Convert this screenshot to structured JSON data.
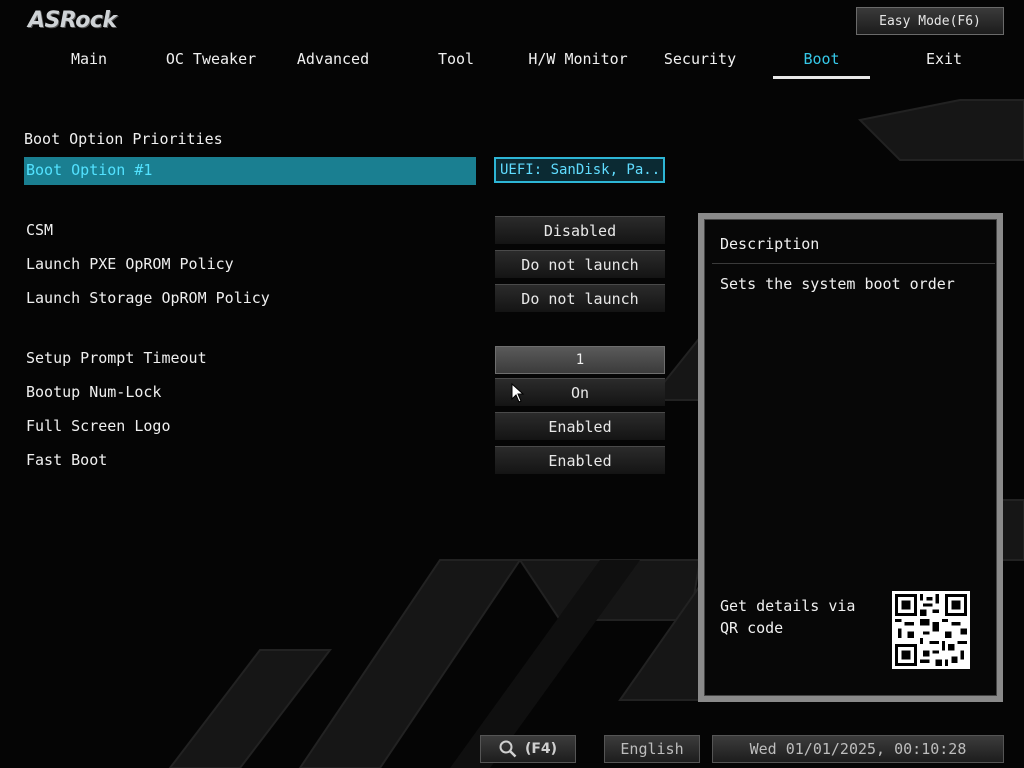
{
  "brand": {
    "logo": "ASRock"
  },
  "header": {
    "easy_mode_label": "Easy Mode(F6)"
  },
  "tabs": [
    {
      "label": "Main"
    },
    {
      "label": "OC Tweaker"
    },
    {
      "label": "Advanced"
    },
    {
      "label": "Tool"
    },
    {
      "label": "H/W Monitor"
    },
    {
      "label": "Security"
    },
    {
      "label": "Boot",
      "active": true
    },
    {
      "label": "Exit"
    }
  ],
  "boot": {
    "section_title": "Boot Option Priorities",
    "option1_label": "Boot Option #1",
    "option1_value": "UEFI: SanDisk, Pa...",
    "settings": [
      {
        "label": "CSM",
        "value": "Disabled"
      },
      {
        "label": "Launch PXE OpROM Policy",
        "value": "Do not launch"
      },
      {
        "label": "Launch Storage OpROM Policy",
        "value": "Do not launch"
      },
      {
        "label": "Setup Prompt Timeout",
        "value": "1"
      },
      {
        "label": "Bootup Num-Lock",
        "value": "On"
      },
      {
        "label": "Full Screen Logo",
        "value": "Enabled"
      },
      {
        "label": "Fast Boot",
        "value": "Enabled"
      }
    ]
  },
  "description": {
    "title": "Description",
    "text": "Sets the system boot order",
    "qr_text": "Get details via QR code"
  },
  "footer": {
    "search_key": "(F4)",
    "language": "English",
    "datetime": "Wed 01/01/2025, 00:10:28"
  },
  "colors": {
    "accent": "#36c8e8",
    "selected_bg": "#1a7f91",
    "background": "#050505"
  }
}
